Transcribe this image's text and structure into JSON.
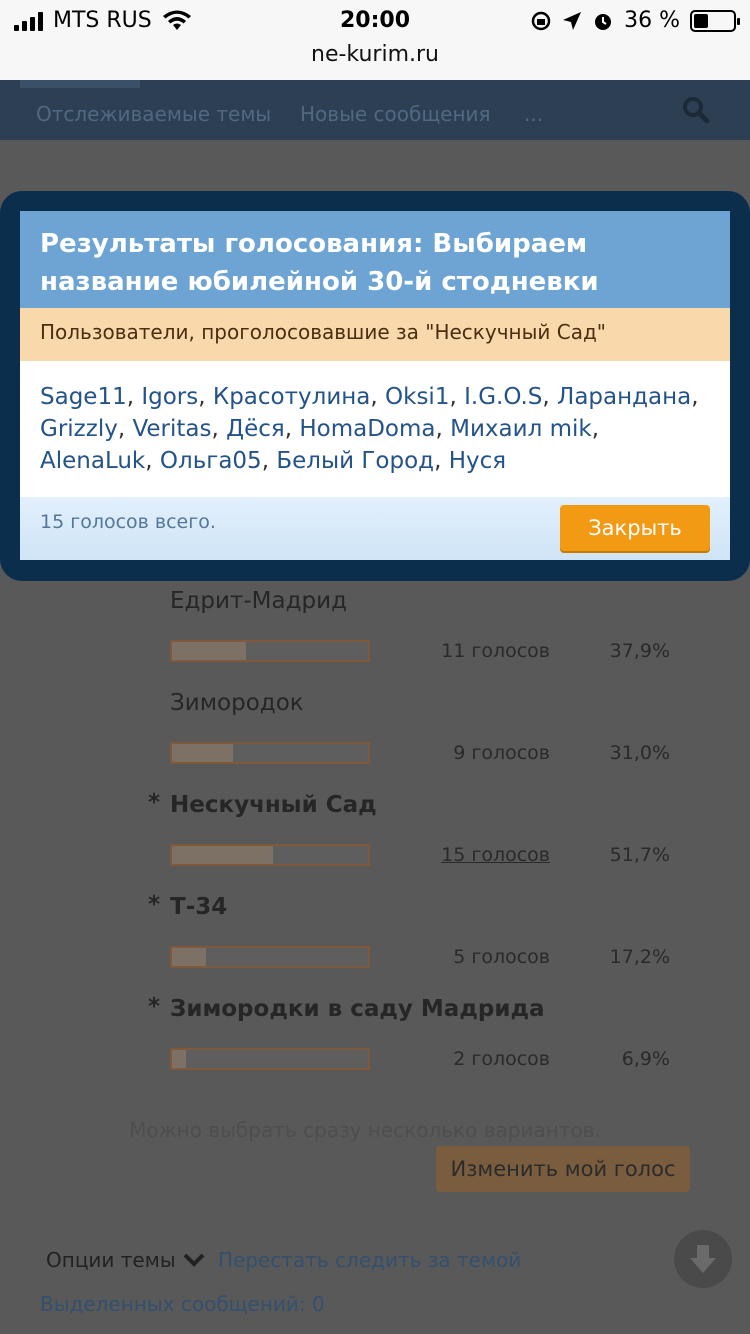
{
  "status_bar": {
    "carrier": "MTS RUS",
    "time": "20:00",
    "battery": "36 %",
    "url": "ne-kurim.ru"
  },
  "nav": {
    "watched": "Отслеживаемые темы",
    "new_posts": "Новые сообщения",
    "more": "..."
  },
  "modal": {
    "title": "Результаты голосования: Выбираем название юбилейной 30-й стодневки",
    "subtitle": "Пользователи, проголосовавшие за \"Нескучный Сад\"",
    "users": [
      "Sage11",
      "Igors",
      "Красотулина",
      "Oksi1",
      "I.G.O.S",
      "Ларандана",
      "Grizzly",
      "Veritas",
      "Дёся",
      "HomaDoma",
      "Михаил mik",
      "AlenaLuk",
      "Ольга05",
      "Белый Город",
      "Нуся"
    ],
    "separator": ",",
    "total": "15 голосов всего.",
    "close_label": "Закрыть"
  },
  "poll": {
    "options": [
      {
        "label": "Едрит-Мадрид",
        "votes": "11 голосов",
        "percent": "37,9%",
        "share": 0.379,
        "selected": false
      },
      {
        "label": "Зимородок",
        "votes": "9 голосов",
        "percent": "31,0%",
        "share": 0.31,
        "selected": false
      },
      {
        "label": "Нескучный Сад",
        "votes": "15 голосов",
        "percent": "51,7%",
        "share": 0.517,
        "selected": true
      },
      {
        "label": "Т-34",
        "votes": "5 голосов",
        "percent": "17,2%",
        "share": 0.172,
        "selected": true
      },
      {
        "label": "Зимородки в саду Мадрида",
        "votes": "2 голосов",
        "percent": "6,9%",
        "share": 0.069,
        "selected": true
      }
    ],
    "star": "*",
    "hint": "Можно выбрать сразу несколько вариантов.",
    "change_vote": "Изменить мой голос"
  },
  "footer": {
    "thread_options": "Опции темы",
    "unwatch": "Перестать следить за темой",
    "selected_posts": "Выделенных сообщений: 0"
  }
}
